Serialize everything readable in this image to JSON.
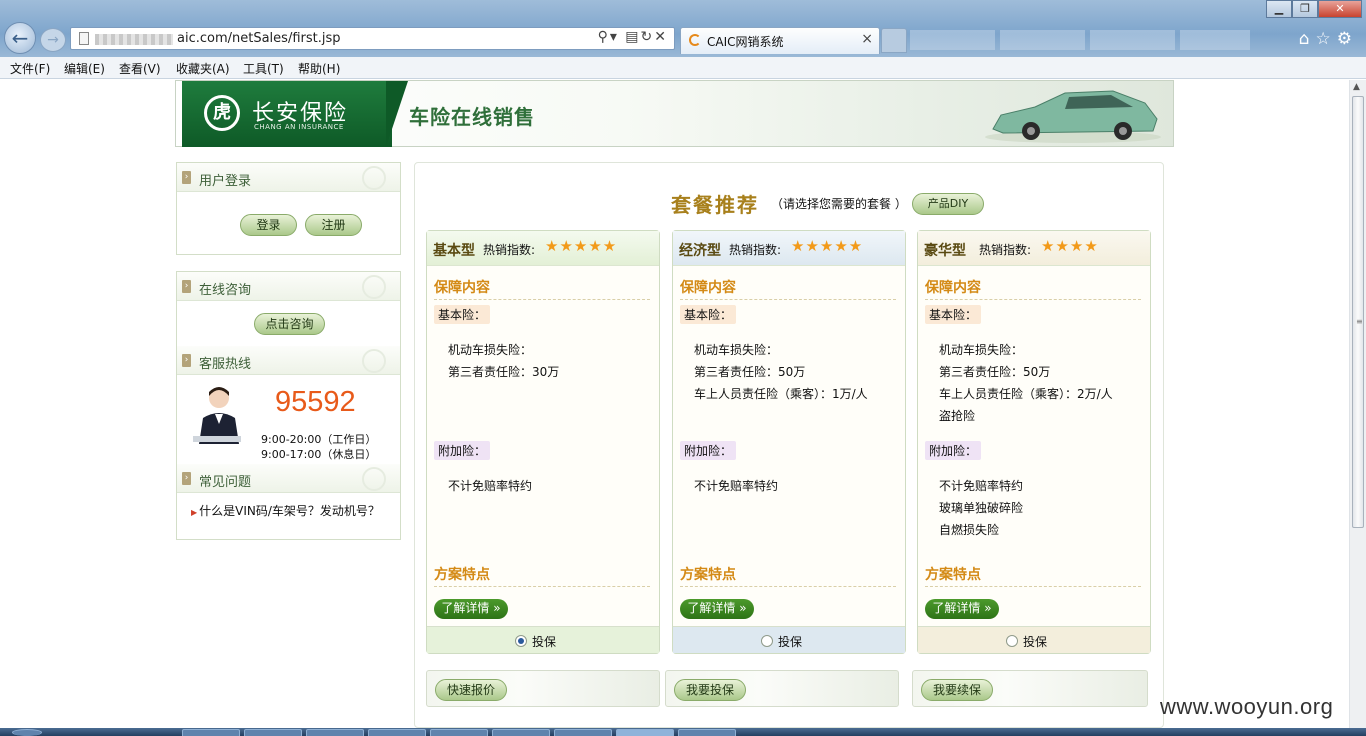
{
  "browser": {
    "url_visible": "aic.com/netSales/first.jsp",
    "tab_title": "CAIC网销系统",
    "menu": [
      "文件(F)",
      "编辑(E)",
      "查看(V)",
      "收藏夹(A)",
      "工具(T)",
      "帮助(H)"
    ]
  },
  "banner": {
    "logo_cn": "长安保险",
    "logo_en": "CHANG AN INSURANCE",
    "title": "车险在线销售"
  },
  "sidebar": {
    "login": {
      "title": "用户登录",
      "login_label": "登录",
      "register_label": "注册"
    },
    "consult": {
      "title": "在线咨询",
      "button_label": "点击咨询"
    },
    "hotline": {
      "title": "客服热线",
      "number": "95592",
      "hours_workday": "9:00-20:00（工作日）",
      "hours_holiday": "9:00-17:00（休息日）"
    },
    "faq": {
      "title": "常见问题",
      "item": "什么是VIN码/车架号？发动机号？"
    }
  },
  "recommend": {
    "title": "套餐推荐",
    "subtitle": "（请选择您需要的套餐 ）",
    "diy_label": "产品DIY",
    "hot_label": "热销指数:",
    "coverage_label": "保障内容",
    "basic_label": "基本险：",
    "addon_label": "附加险：",
    "features_label": "方案特点",
    "detail_label": "了解详情",
    "insure_label": "投保",
    "packages": [
      {
        "name": "基本型",
        "stars": 5,
        "stars_text": "★★★★★",
        "basic": [
          "机动车损失险：",
          "第三者责任险：30万"
        ],
        "addon": [
          "不计免赔率特约"
        ],
        "selected": true
      },
      {
        "name": "经济型",
        "stars": 5,
        "stars_text": "★★★★★",
        "basic": [
          "机动车损失险：",
          "第三者责任险：50万",
          "车上人员责任险（乘客）：1万/人"
        ],
        "addon": [
          "不计免赔率特约"
        ],
        "selected": false
      },
      {
        "name": "豪华型",
        "stars": 4,
        "stars_text": "★★★★",
        "basic": [
          "机动车损失险：",
          "第三者责任险：50万",
          "车上人员责任险（乘客）：2万/人",
          "盗抢险"
        ],
        "addon": [
          "不计免赔率特约",
          "玻璃单独破碎险",
          "自燃损失险"
        ],
        "selected": false
      }
    ],
    "actions": {
      "quote": "快速报价",
      "insure": "我要投保",
      "renew": "我要续保"
    }
  },
  "watermark": "www.wooyun.org",
  "colors": {
    "brand_green": "#0e5a27",
    "accent_orange": "#d48a16",
    "hotline_orange": "#e85a1a",
    "economy_head": "#dde8f0",
    "luxury_head": "#f3eedc",
    "basic_head": "#e6f2da"
  }
}
